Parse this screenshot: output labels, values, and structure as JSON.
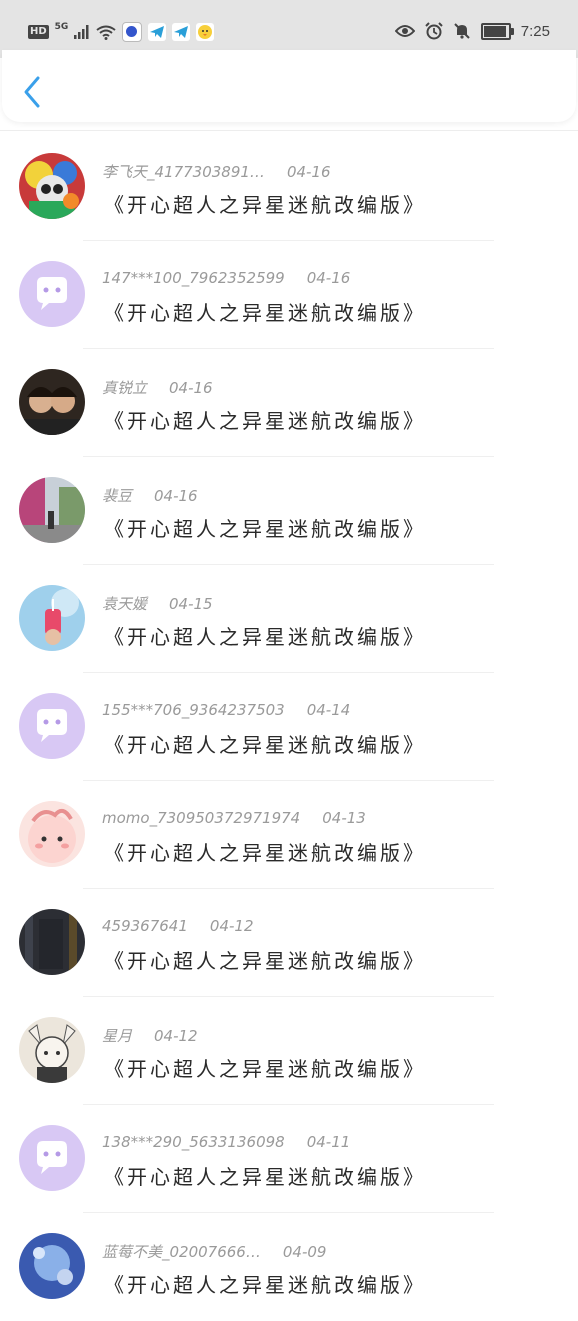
{
  "status_bar": {
    "hd": "HD",
    "network": "5G",
    "time": "7:25",
    "icons_left": [
      "hd-icon",
      "signal-icon",
      "wifi-icon",
      "app-notification-icon",
      "telegram-icon",
      "telegram-icon",
      "chick-app-icon"
    ],
    "icons_right": [
      "eye-icon",
      "alarm-icon",
      "mute-icon",
      "battery-icon"
    ]
  },
  "header": {
    "back_icon": "chevron-left-icon",
    "accent": "#3aa0ea"
  },
  "comments": [
    {
      "user": "李飞天_4177303891…",
      "date": "04-16",
      "text": "《开心超人之异星迷航改编版》",
      "avatar": "cartoon"
    },
    {
      "user": "147***100_7962352599",
      "date": "04-16",
      "text": "《开心超人之异星迷航改编版》",
      "avatar": "default"
    },
    {
      "user": "真锐立",
      "date": "04-16",
      "text": "《开心超人之异星迷航改编版》",
      "avatar": "photo-dark"
    },
    {
      "user": "裴豆",
      "date": "04-16",
      "text": "《开心超人之异星迷航改编版》",
      "avatar": "photo-pink"
    },
    {
      "user": "袁天媛",
      "date": "04-15",
      "text": "《开心超人之异星迷航改编版》",
      "avatar": "photo-sky"
    },
    {
      "user": "155***706_9364237503",
      "date": "04-14",
      "text": "《开心超人之异星迷航改编版》",
      "avatar": "default"
    },
    {
      "user": "momo_730950372971974",
      "date": "04-13",
      "text": "《开心超人之异星迷航改编版》",
      "avatar": "pink-character"
    },
    {
      "user": "459367641",
      "date": "04-12",
      "text": "《开心超人之异星迷航改编版》",
      "avatar": "dark-gradient"
    },
    {
      "user": "星月",
      "date": "04-12",
      "text": "《开心超人之异星迷航改编版》",
      "avatar": "anime-girl"
    },
    {
      "user": "138***290_5633136098",
      "date": "04-11",
      "text": "《开心超人之异星迷航改编版》",
      "avatar": "default"
    },
    {
      "user": "蓝莓不美_02007666…",
      "date": "04-09",
      "text": "《开心超人之异星迷航改编版》",
      "avatar": "blue-art"
    }
  ]
}
